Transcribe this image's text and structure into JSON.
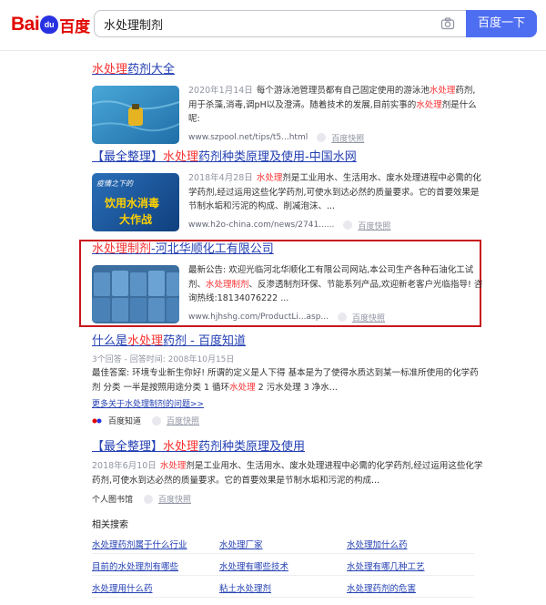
{
  "header": {
    "logo_bai": "Bai",
    "logo_du_mark": "du",
    "logo_du": "百度",
    "query": "水处理制剂",
    "search_button": "百度一下"
  },
  "results": [
    {
      "title": [
        "",
        "水处理",
        "药剂大全"
      ],
      "date": "2020年1月14日",
      "text": [
        "每个游泳池管理员都有自己固定使用的游泳池",
        "水处理",
        "药剂,用于杀藻,消毒,调pH以及澄清。随着技术的发展,目前实事的",
        "水处理",
        "剂是什么呢:"
      ],
      "url": "www.szpool.net/tips/t5...html",
      "snapshot": "百度快照"
    },
    {
      "title": [
        "【最全整理】",
        "水处理",
        "药剂种类原理及使用-中国水网"
      ],
      "date": "2018年4月28日",
      "text": [
        "",
        "水处理",
        "剂是工业用水、生活用水、废水处理进程中必需的化学药剂,经过运用这些化学药剂,可使水到达必然的质量要求。它的首要效果是节制水垢和污泥的构成、削减泡沫、..."
      ],
      "thumb_caption_1": "疫情之下的",
      "thumb_caption_2": "饮用水消毒",
      "thumb_caption_3": "大作战",
      "url": "www.h2o-china.com/news/2741......",
      "snapshot": "百度快照"
    },
    {
      "title": [
        "",
        "水处理制剂",
        "-河北华顺化工有限公司"
      ],
      "text": [
        "最新公告: 欢迎光临河北华顺化工有限公司网站,本公司生产各种石油化工试剂、",
        "水处理制剂",
        "、反渗透制剂环保、节能系列产品,欢迎新老客户光临指导! 咨询热线:18134076222 ..."
      ],
      "url": "www.hjhshg.com/ProductLi...asp...",
      "snapshot": "百度快照"
    },
    {
      "title": [
        "什么是",
        "水处理",
        "药剂 - 百度知道"
      ],
      "meta": "3个回答 - 回答时间: 2008年10月15日",
      "text": [
        "最佳答案: 环境专业新生你好! 所谓的定义是人下得 基本是为了使得水质达到某一标准所使用的化学药剂 分类 一半是按照用途分类 1 循环",
        "水处理",
        " 2 污水处理 3 净水..."
      ],
      "more": "更多关于水处理制剂的问题>>",
      "source": "百度知道",
      "snapshot": "百度快照"
    },
    {
      "title": [
        "【最全整理】",
        "水处理",
        "药剂种类原理及使用"
      ],
      "date": "2018年6月10日",
      "text": [
        "",
        "水处理",
        "剂是工业用水、生活用水、废水处理进程中必需的化学药剂,经过运用这些化学药剂,可使水到达必然的质量要求。它的首要效果是节制水垢和污泥的构成..."
      ],
      "source": "个人图书馆",
      "snapshot": "百度快照"
    }
  ],
  "related": {
    "heading": "相关搜索",
    "items": [
      "水处理药剂属于什么行业",
      "水处理厂家",
      "水处理加什么药",
      "目前的水处理剂有哪些",
      "水处理有哪些技术",
      "水处理有哪几种工艺",
      "水处理用什么药",
      "粘土水处理剂",
      "水处理药剂的危害"
    ]
  },
  "colors": {
    "brand_red": "#e10601",
    "brand_blue": "#2932e1",
    "link": "#2440b3",
    "highlight": "#f73131",
    "button": "#4e6ef2",
    "frame": "#c8161d"
  }
}
